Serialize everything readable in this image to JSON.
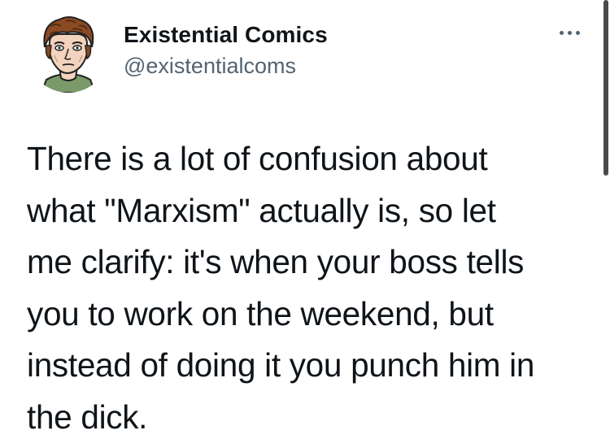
{
  "author": {
    "display_name": "Existential Comics",
    "handle": "@existentialcoms",
    "avatar_icon": "cartoon-portrait-avatar"
  },
  "menu": {
    "icon": "more-options-icon"
  },
  "tweet": {
    "lines": [
      "There is a lot of confusion about",
      "what \"Marxism\" actually is, so let",
      "me clarify: it's when your boss tells",
      "you to work on the weekend, but",
      "instead of doing it you punch him in",
      "the dick."
    ]
  },
  "colors": {
    "text": "#0f1419",
    "secondary": "#536471",
    "background": "#ffffff"
  }
}
